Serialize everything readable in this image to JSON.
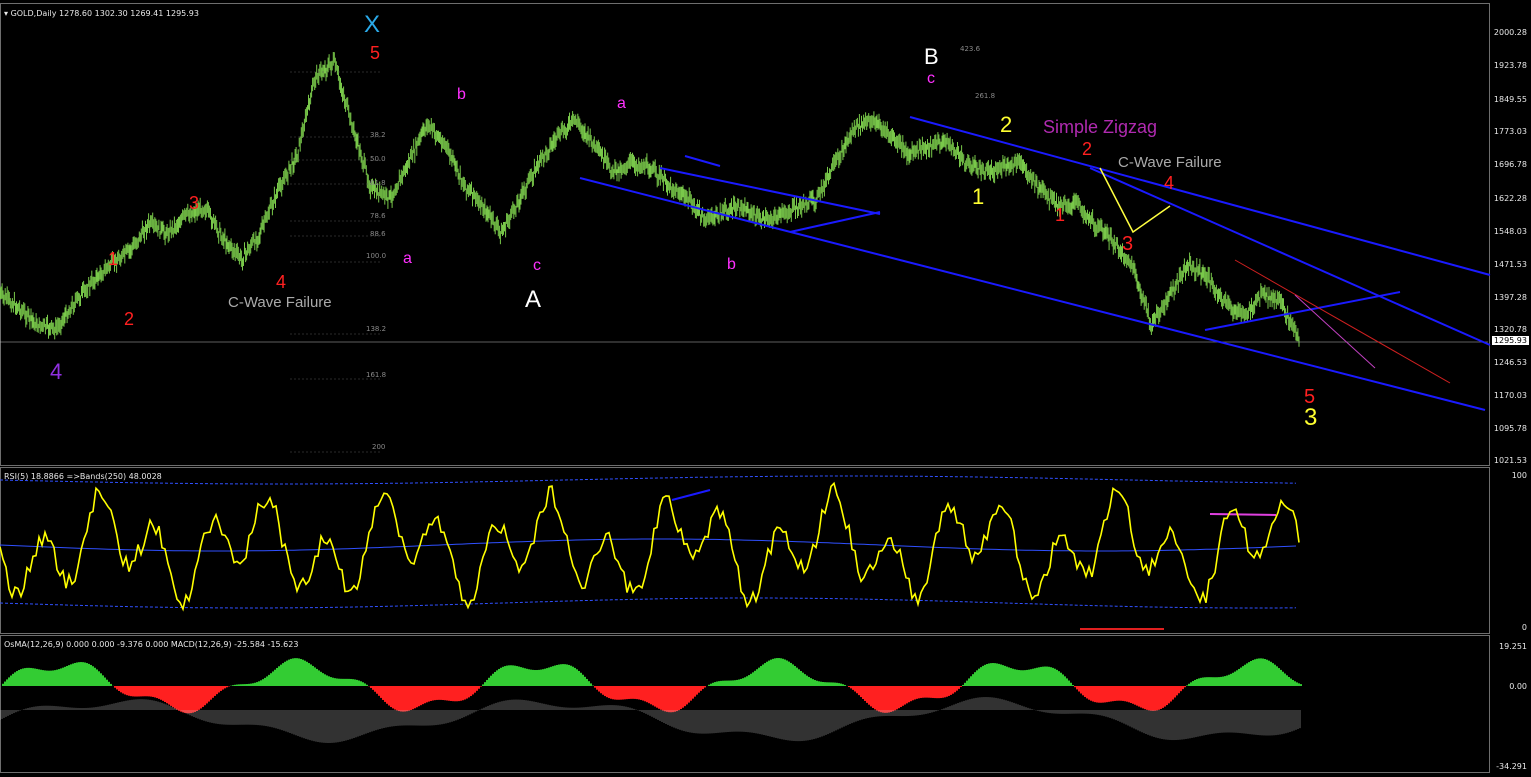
{
  "header": {
    "symbol": "GOLD,Daily",
    "ohlc": "1278.60 1302.30 1269.41 1295.93",
    "rsi": "RSI(5) 18.8866  =>Bands(250) 48.0028",
    "macd": "OsMA(12,26,9) 0.000 0.000 -9.376 0.000  MACD(12,26,9) -25.584 -15.623"
  },
  "price_axis": [
    "2000.28",
    "1923.78",
    "1849.55",
    "1773.03",
    "1696.78",
    "1622.28",
    "1548.03",
    "1471.53",
    "1397.28",
    "1320.78",
    "1246.53",
    "1170.03",
    "1095.78",
    "1021.53"
  ],
  "current_price": "1295.93",
  "rsi_axis": [
    "100",
    "0"
  ],
  "macd_axis": [
    "19.251",
    "0.00",
    "-34.291"
  ],
  "fib_levels": [
    "423.6",
    "261.8",
    "161.8",
    "138.2",
    "100.0",
    "61.8",
    "50.0",
    "38.2",
    "78.6",
    "88.6",
    "100.0",
    "138.2",
    "161.8",
    "200"
  ],
  "labels": {
    "X": "X",
    "five_top": "5",
    "B_big": "B",
    "c_mag": "c",
    "A_big": "A",
    "two_y": "2",
    "one_y": "1",
    "three_y": "3",
    "simple_zigzag": "Simple Zigzag",
    "cwave1": "C-Wave Failure",
    "cwave2": "C-Wave Failure",
    "r1": "1",
    "r2": "2",
    "r3": "3",
    "r4": "4",
    "four_purple": "4",
    "a1": "a",
    "b1": "b",
    "c1": "c",
    "a2": "a",
    "b2": "b",
    "red1": "1",
    "red2": "2",
    "red3": "3",
    "red4": "4",
    "red5": "5"
  },
  "colors": {
    "candle": "#79c84a",
    "trend": "#1a1aff",
    "rsi": "#ffff00",
    "band": "#3050ff",
    "hist_pos": "#33cc33",
    "hist_neg": "#ff2020",
    "macd": "#c8c8c8"
  },
  "chart_data": {
    "type": "line",
    "title": "GOLD,Daily",
    "ylim": [
      1021.53,
      2000.28
    ],
    "series": [
      {
        "name": "GOLD,Daily",
        "values": [
          1400,
          1370,
          1330,
          1320,
          1380,
          1430,
          1470,
          1500,
          1560,
          1540,
          1580,
          1600,
          1530,
          1480,
          1540,
          1640,
          1720,
          1900,
          1930,
          1780,
          1640,
          1620,
          1700,
          1790,
          1740,
          1650,
          1600,
          1540,
          1620,
          1700,
          1760,
          1800,
          1740,
          1680,
          1700,
          1690,
          1650,
          1620,
          1570,
          1590,
          1600,
          1570,
          1580,
          1600,
          1620,
          1700,
          1780,
          1800,
          1760,
          1720,
          1740,
          1750,
          1700,
          1680,
          1690,
          1700,
          1640,
          1600,
          1610,
          1560,
          1520,
          1460,
          1330,
          1400,
          1470,
          1440,
          1380,
          1350,
          1400,
          1380,
          1295.93
        ]
      }
    ]
  }
}
